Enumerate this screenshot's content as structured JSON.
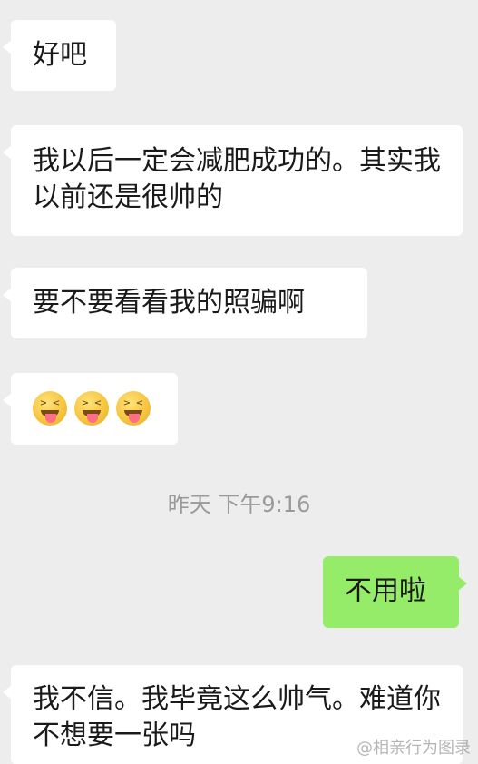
{
  "messages": [
    {
      "side": "left",
      "text": "好吧"
    },
    {
      "side": "left",
      "text": "我以后一定会减肥成功的。其实我以前还是很帅的"
    },
    {
      "side": "left",
      "text": "要不要看看我的照骗啊"
    },
    {
      "side": "left",
      "emoji": [
        "face-with-tongue-squinting-icon",
        "face-with-tongue-squinting-icon",
        "face-with-tongue-squinting-icon"
      ]
    },
    {
      "side": "right",
      "text": "不用啦"
    },
    {
      "side": "left",
      "text": "我不信。我毕竟这么帅气。难道你不想要一张吗"
    }
  ],
  "timestamp": "昨天 下午9:16",
  "watermark": "@相亲行为图录",
  "colors": {
    "background": "#ededed",
    "incoming_bubble": "#ffffff",
    "outgoing_bubble": "#95ec69",
    "timestamp_text": "#9a9a9a"
  }
}
